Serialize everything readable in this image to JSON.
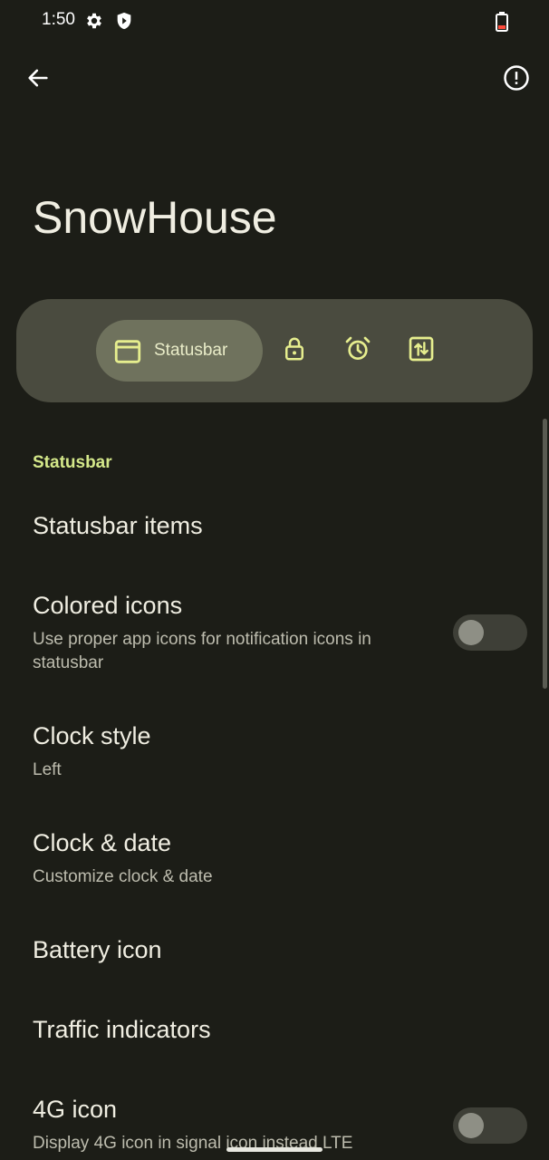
{
  "status_bar": {
    "time": "1:50",
    "icons": [
      "gear-icon",
      "shield-icon",
      "battery-icon"
    ],
    "battery_color": "#ff4a3a"
  },
  "app_bar": {
    "back_icon": "arrow-back-icon",
    "info_icon": "alert-circle-icon"
  },
  "page": {
    "title": "SnowHouse"
  },
  "tabs": {
    "active_label": "Statusbar",
    "items": [
      {
        "name": "statusbar",
        "icon": "window-icon",
        "label": "Statusbar",
        "active": true
      },
      {
        "name": "lockscreen",
        "icon": "lock-icon",
        "active": false
      },
      {
        "name": "alarm",
        "icon": "alarm-icon",
        "active": false
      },
      {
        "name": "data-traffic",
        "icon": "swap-vertical-icon",
        "active": false
      }
    ]
  },
  "section": {
    "header": "Statusbar"
  },
  "prefs": [
    {
      "title": "Statusbar items",
      "summary": null,
      "toggle": null
    },
    {
      "title": "Colored icons",
      "summary": "Use proper app icons for notification icons in statusbar",
      "toggle": false
    },
    {
      "title": "Clock style",
      "summary": "Left",
      "toggle": null
    },
    {
      "title": "Clock & date",
      "summary": "Customize clock & date",
      "toggle": null
    },
    {
      "title": "Battery icon",
      "summary": null,
      "toggle": null
    },
    {
      "title": "Traffic indicators",
      "summary": null,
      "toggle": null
    },
    {
      "title": "4G icon",
      "summary": "Display 4G icon in signal icon instead LTE",
      "toggle": false
    }
  ],
  "colors": {
    "background": "#1c1d17",
    "accent": "#d4e88a",
    "tab_bar": "#4a4b3f",
    "tab_active": "#6f725d"
  }
}
